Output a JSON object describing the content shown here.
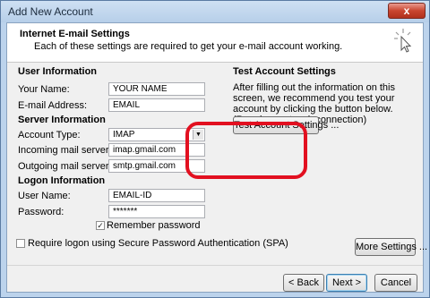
{
  "window": {
    "title": "Add New Account",
    "close_label": "x"
  },
  "header": {
    "title": "Internet E-mail Settings",
    "description": "Each of these settings are required to get your e-mail account working."
  },
  "user_info": {
    "section_label": "User Information",
    "name_label": "Your Name:",
    "name_value": "YOUR NAME",
    "email_label": "E-mail Address:",
    "email_value": "EMAIL"
  },
  "server_info": {
    "section_label": "Server Information",
    "account_type_label": "Account Type:",
    "account_type_value": "IMAP",
    "incoming_label": "Incoming mail server:",
    "incoming_value": "imap.gmail.com",
    "outgoing_label": "Outgoing mail server (SMTP):",
    "outgoing_value": "smtp.gmail.com"
  },
  "logon_info": {
    "section_label": "Logon Information",
    "username_label": "User Name:",
    "username_value": "EMAIL-ID",
    "password_label": "Password:",
    "password_value": "*******",
    "remember_label": "Remember password",
    "remember_checked": true,
    "spa_label": "Require logon using Secure Password Authentication (SPA)",
    "spa_checked": false
  },
  "test_settings": {
    "section_label": "Test Account Settings",
    "description": "After filling out the information on this screen, we recommend you test your account by clicking the button below. (Requires network connection)",
    "button_label": "Test Account Settings ..."
  },
  "buttons": {
    "more_settings": "More Settings ...",
    "back": "< Back",
    "next": "Next >",
    "cancel": "Cancel"
  },
  "colors": {
    "highlight": "#e21020",
    "title_bar": "#bcd3ec"
  },
  "icons": {
    "header_icon": "cursor-click-icon",
    "close": "close-icon",
    "dropdown": "chevron-down-icon"
  }
}
